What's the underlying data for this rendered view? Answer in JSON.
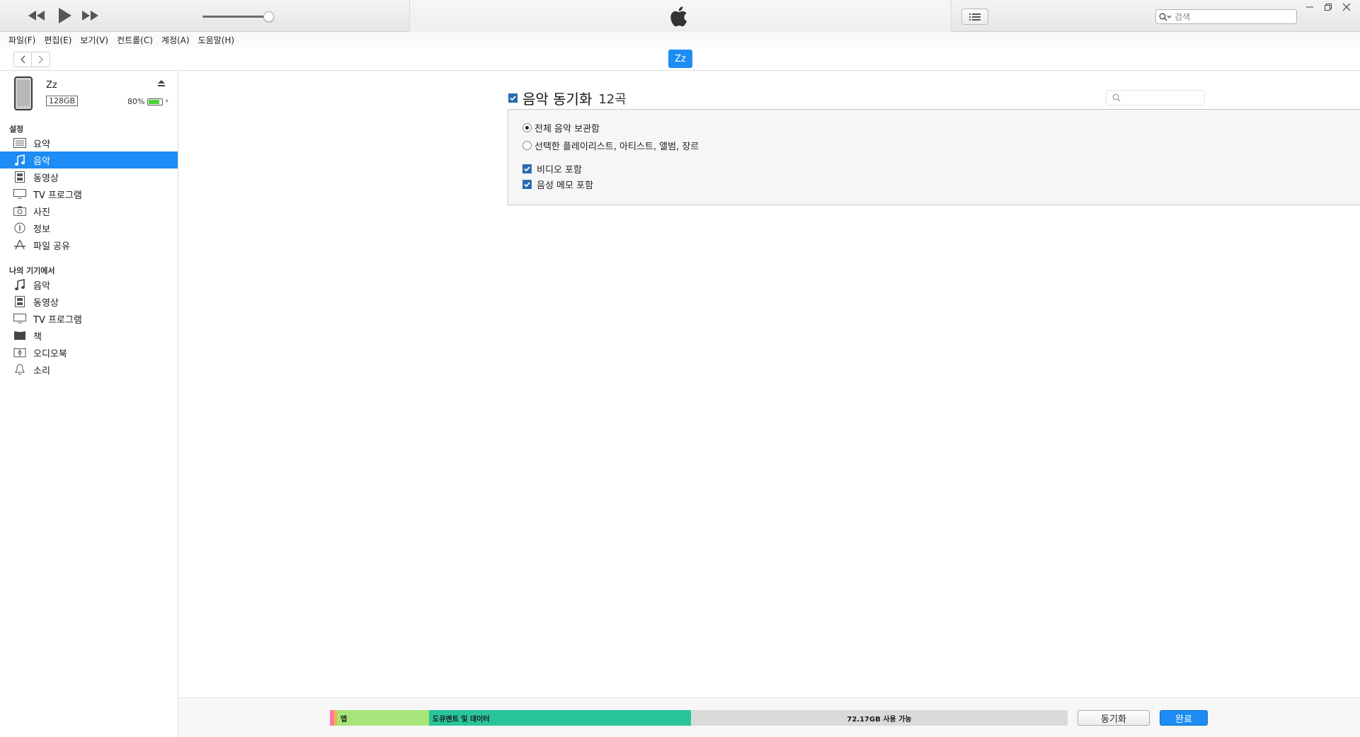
{
  "header": {
    "search_placeholder": "검색",
    "window_controls": [
      "minimize",
      "restore",
      "close"
    ]
  },
  "menu": [
    "파일(F)",
    "편집(E)",
    "보기(V)",
    "컨트롤(C)",
    "계정(A)",
    "도움말(H)"
  ],
  "nav": {
    "device_button": "Zz"
  },
  "device": {
    "name": "Zz",
    "capacity": "128GB",
    "battery": "80%",
    "battery_level_fraction": 0.8
  },
  "sidebar": {
    "settings_title": "설정",
    "settings_items": [
      {
        "label": "요약",
        "icon": "summary-icon",
        "active": false
      },
      {
        "label": "음악",
        "icon": "music-note-icon",
        "active": true
      },
      {
        "label": "동영상",
        "icon": "film-icon",
        "active": false
      },
      {
        "label": "TV 프로그램",
        "icon": "tv-icon",
        "active": false
      },
      {
        "label": "사진",
        "icon": "camera-icon",
        "active": false
      },
      {
        "label": "정보",
        "icon": "info-icon",
        "active": false
      },
      {
        "label": "파일 공유",
        "icon": "app-store-icon",
        "active": false
      }
    ],
    "ondevice_title": "나의 기기에서",
    "ondevice_items": [
      {
        "label": "음악",
        "icon": "music-note-icon"
      },
      {
        "label": "동영상",
        "icon": "film-icon"
      },
      {
        "label": "TV 프로그램",
        "icon": "tv-icon"
      },
      {
        "label": "책",
        "icon": "book-icon"
      },
      {
        "label": "오디오북",
        "icon": "audiobook-icon"
      },
      {
        "label": "소리",
        "icon": "bell-icon"
      }
    ]
  },
  "main": {
    "sync_title": "음악 동기화",
    "sync_count": "12곡",
    "sync_checked": true,
    "options": {
      "entire_library": "전체 음악 보관함",
      "selected": "선택한 플레이리스트, 아티스트, 앨범, 장르",
      "include_videos": "비디오 포함",
      "include_voice_memos": "음성 메모 포함"
    },
    "selected_radio": "entire_library"
  },
  "footer": {
    "storage": {
      "apps_label": "앱",
      "docs_label": "도큐멘트 및 데이터",
      "free_label": "72.17GB 사용 가능"
    },
    "sync_button": "동기화",
    "done_button": "완료"
  },
  "colors": {
    "accent": "#1d8cf4",
    "apps": "#a7e57a",
    "docs": "#2ac49a",
    "free": "#dadada",
    "battery": "#4cd137"
  }
}
